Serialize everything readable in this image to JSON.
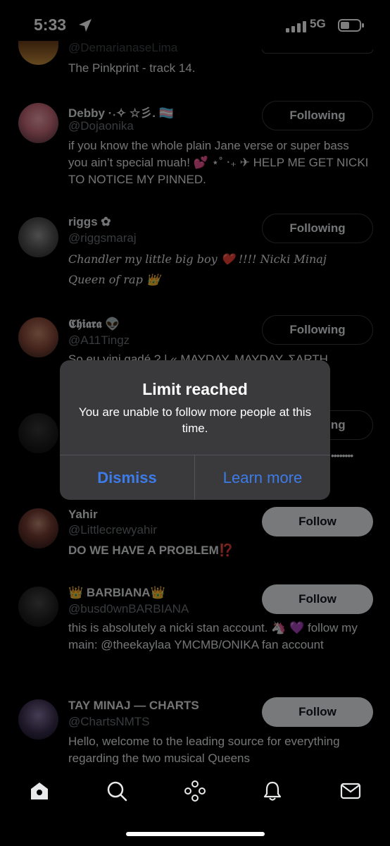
{
  "status": {
    "time": "5:33",
    "network": "5G"
  },
  "partial_top": {
    "handle": "@DemarianaseLima",
    "bio": "The Pinkprint - track 14."
  },
  "users": [
    {
      "name": "Debby ·˖✧ ☆彡. 🏳️‍⚧️",
      "handle": "@Dojaonika",
      "bio": "if you know the whole plain Jane verse or super bass you ain’t special muah! 💕 ⋆˚ ‧₊ ✈ HELP ME GET NICKI TO NOTICE MY PINNED.",
      "button": "Following"
    },
    {
      "name": "riggs ✿",
      "handle": "@riggsmaraj",
      "bio": "Chandler my little big boy ❤️ !!!! Nicki Minaj Queen of rap 👑",
      "button": "Following"
    },
    {
      "name": "𝕮𝖍𝖎𝖆𝖗𝖆 👽",
      "handle": "@A11Tingz",
      "bio": "So eu vini gadé ? | « MAYDAY, MAYDAY, ƩARTH",
      "button": "Following"
    },
    {
      "name": "",
      "handle": "",
      "bio": "••••••••",
      "button": "Following"
    },
    {
      "name": "Yahir",
      "handle": "@Littlecrewyahir",
      "bio": "DO WE HAVE A PROBLEM⁉️",
      "button": "Follow"
    },
    {
      "name": "👑 BARBIANA👑",
      "handle": "@busd0wnBARBIANA",
      "bio": "this is absolutely a nicki stan account. 🦄 💜 follow my main: @theekaylaa YMCMB/ONIKA fan account",
      "button": "Follow"
    },
    {
      "name": "TAY MINAJ — CHARTS",
      "handle": "@ChartsNMTS",
      "bio": "Hello, welcome to the leading source for everything regarding the two musical Queens",
      "button": "Follow"
    }
  ],
  "dialog": {
    "title": "Limit reached",
    "message": "You are unable to follow more people at this time.",
    "dismiss": "Dismiss",
    "learn_more": "Learn more"
  },
  "tabs": [
    "home-icon",
    "search-icon",
    "spaces-icon",
    "notifications-icon",
    "messages-icon"
  ],
  "colors": {
    "background": "#000000",
    "dialog": "#3a3a3c",
    "link": "#3d7ce8",
    "follow_button": "#eff3f4"
  }
}
